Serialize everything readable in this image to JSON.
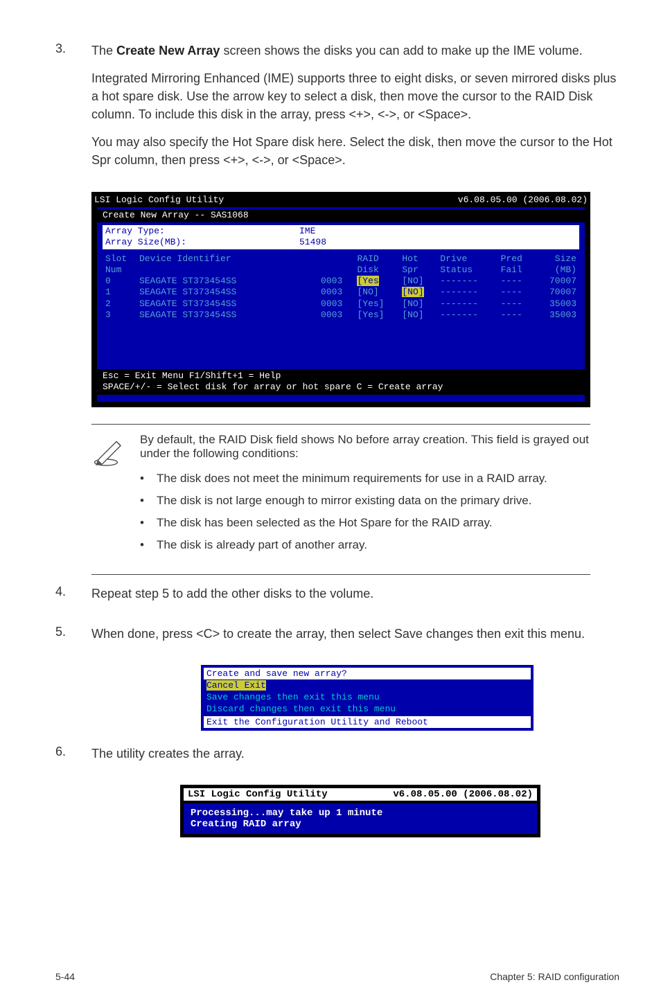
{
  "step3": {
    "num": "3.",
    "p1_a": "The ",
    "p1_b": "Create New Array",
    "p1_c": " screen shows the disks you can add to make up the IME volume.",
    "p2": "Integrated Mirroring Enhanced (IME) supports  three to eight disks, or seven mirrored disks plus a hot spare disk. Use the arrow key to select a disk, then move the cursor to the RAID Disk column. To include this disk in the array, press <+>, <->, or <Space>.",
    "p3": "You may also specify the Hot Spare disk here. Select the disk, then move the cursor to the Hot Spr column, then press <+>, <->, or <Space>."
  },
  "bios": {
    "title_l": "LSI Logic Config Utility",
    "title_r": "v6.08.05.00 (2006.08.02)",
    "subtitle": "Create New Array -- SAS1068",
    "arraytype_label": "Array Type:",
    "arraysize_label": "Array Size(MB):",
    "ime_label": "IME",
    "arraysize_value": "51498",
    "hdr": {
      "slot1": "Slot",
      "slot2": "Num",
      "dev": "Device Identifier",
      "raid1": "RAID",
      "raid2": "Disk",
      "hot1": "Hot",
      "hot2": "Spr",
      "drv1": "Drive",
      "drv2": "Status",
      "pred1": "Pred",
      "pred2": "Fail",
      "size1": "Size",
      "size2": "(MB)"
    },
    "rows": [
      {
        "slot": "0",
        "dev": "SEAGATE ST373454SS",
        "u": "0003",
        "raid": "[Yes",
        "raid_hl": true,
        "hot": "[NO]",
        "hot_hl": false,
        "drv": "-------",
        "pred": "----",
        "size": "70007"
      },
      {
        "slot": "1",
        "dev": "SEAGATE ST373454SS",
        "u": "0003",
        "raid": "[NO]",
        "raid_hl": false,
        "hot": "[NO]",
        "hot_hl": true,
        "drv": "-------",
        "pred": "----",
        "size": "70007"
      },
      {
        "slot": "2",
        "dev": "SEAGATE ST373454SS",
        "u": "0003",
        "raid": "[Yes]",
        "raid_hl": false,
        "hot": "[NO]",
        "hot_hl": false,
        "drv": "-------",
        "pred": "----",
        "size": "35003"
      },
      {
        "slot": "3",
        "dev": "SEAGATE ST373454SS",
        "u": "0003",
        "raid": "[Yes]",
        "raid_hl": false,
        "hot": "[NO]",
        "hot_hl": false,
        "drv": "-------",
        "pred": "----",
        "size": "35003"
      }
    ],
    "foot1": "Esc = Exit Menu   F1/Shift+1 = Help",
    "foot2": "SPACE/+/- = Select disk for array or hot spare   C = Create array"
  },
  "note": {
    "lead": "By default, the RAID Disk field shows No before array creation. This field is grayed out under the following conditions:",
    "b1": "The disk does not meet the  minimum requirements for use in a RAID array.",
    "b2": "The disk is not large enough to mirror existing data on the primary drive.",
    "b3": "The disk has been selected as the Hot Spare for the RAID array.",
    "b4": "The disk is already part of another array."
  },
  "step4": {
    "num": "4.",
    "p": "Repeat step 5 to add the other disks to the volume."
  },
  "step5": {
    "num": "5.",
    "p": "When done, press <C> to create the array, then select Save changes then exit this menu."
  },
  "save": {
    "title": "Create and save new array?",
    "cancel": "Cancel Exit",
    "opt1": "Save changes then exit this menu",
    "opt2": "Discard changes then exit this menu",
    "foot": "Exit the Configuration Utility and Reboot"
  },
  "step6": {
    "num": "6.",
    "p": "The utility creates the array."
  },
  "proc": {
    "bar_l": "LSI Logic Config Utility",
    "bar_r": "v6.08.05.00 (2006.08.02)",
    "l1": "Processing...may take up 1 minute",
    "l2": "Creating RAID array"
  },
  "footer": {
    "l": "5-44",
    "r": "Chapter 5: RAID configuration"
  },
  "bullet": "•"
}
